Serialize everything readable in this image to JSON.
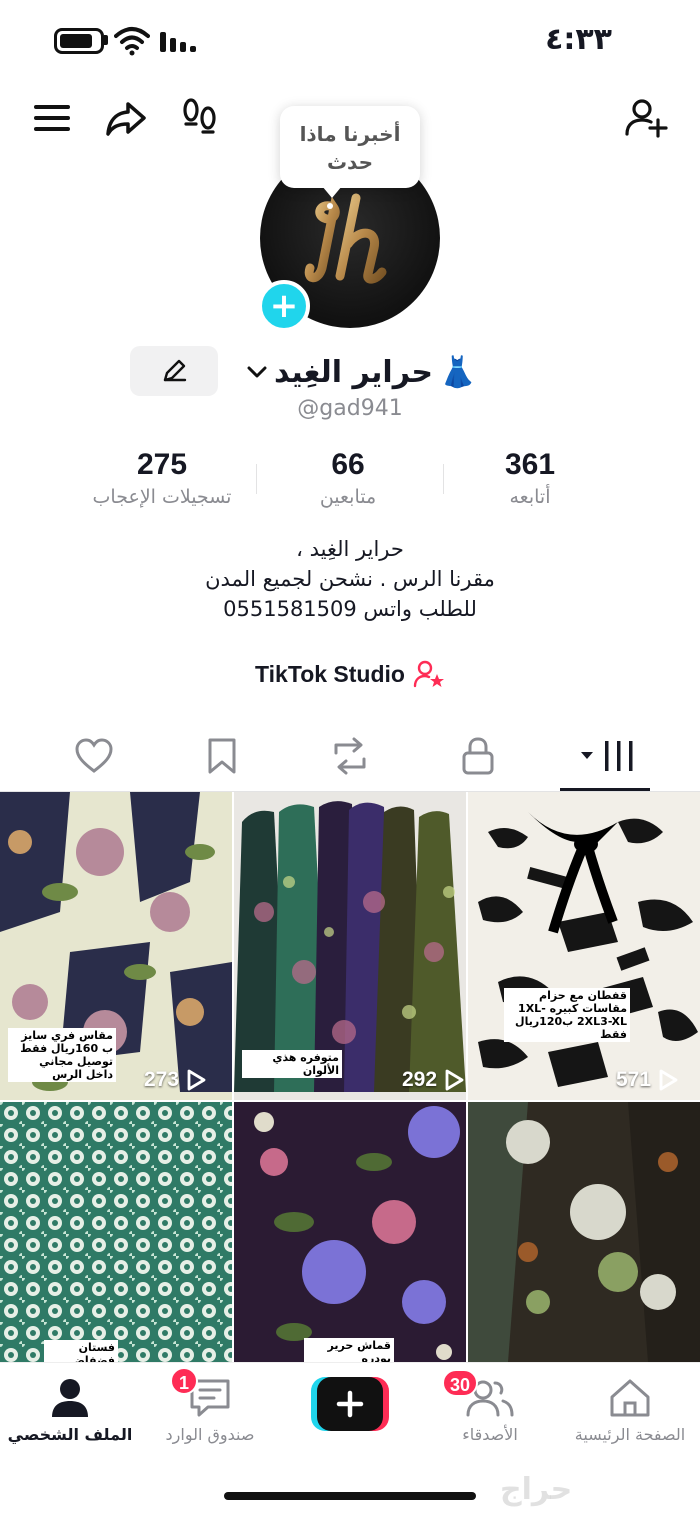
{
  "status_bar": {
    "time": "٤:٣٣",
    "battery_level": 0.85
  },
  "tooltip": {
    "line1": "أخبرنا ماذا",
    "line2": "حدث"
  },
  "profile": {
    "display_name": "حراير الغِيد",
    "name_emoji": "👗",
    "username": "@gad941"
  },
  "stats": [
    {
      "value": "361",
      "label": "أتابعه"
    },
    {
      "value": "66",
      "label": "متابعين"
    },
    {
      "value": "275",
      "label": "تسجيلات الإعجاب"
    }
  ],
  "bio": {
    "line1": "حراير الغِيد ،",
    "line2": "مقرنا الرس . نشحن لجميع المدن",
    "line3": "للطلب واتس 0551581509"
  },
  "studio": {
    "label": "TikTok Studio"
  },
  "videos": [
    {
      "views": "571",
      "caption": "قفطان مع حزام مقاسات كبيره 1XL-2XL3-XL ب120ريال فقط"
    },
    {
      "views": "292",
      "caption": "متوفره هذي الألوان"
    },
    {
      "views": "273",
      "caption": "مقاس فري سايز ب 160ريال فقط توصيل مجاني داخل الرس"
    },
    {
      "views": "",
      "caption": ""
    },
    {
      "views": "",
      "caption": "قماش حرير بودره"
    },
    {
      "views": "",
      "caption": "فستان فضفاض"
    }
  ],
  "bottom_nav": {
    "home": "الصفحة الرئيسية",
    "friends": "الأصدقاء",
    "friends_badge": "30",
    "inbox": "صندوق الوارد",
    "inbox_badge": "1",
    "profile": "الملف الشخصي"
  },
  "watermark": "حراج",
  "colors": {
    "accent": "#fe2c55",
    "cyan": "#20d5ec",
    "text": "#161823",
    "muted": "#8a8b91"
  }
}
